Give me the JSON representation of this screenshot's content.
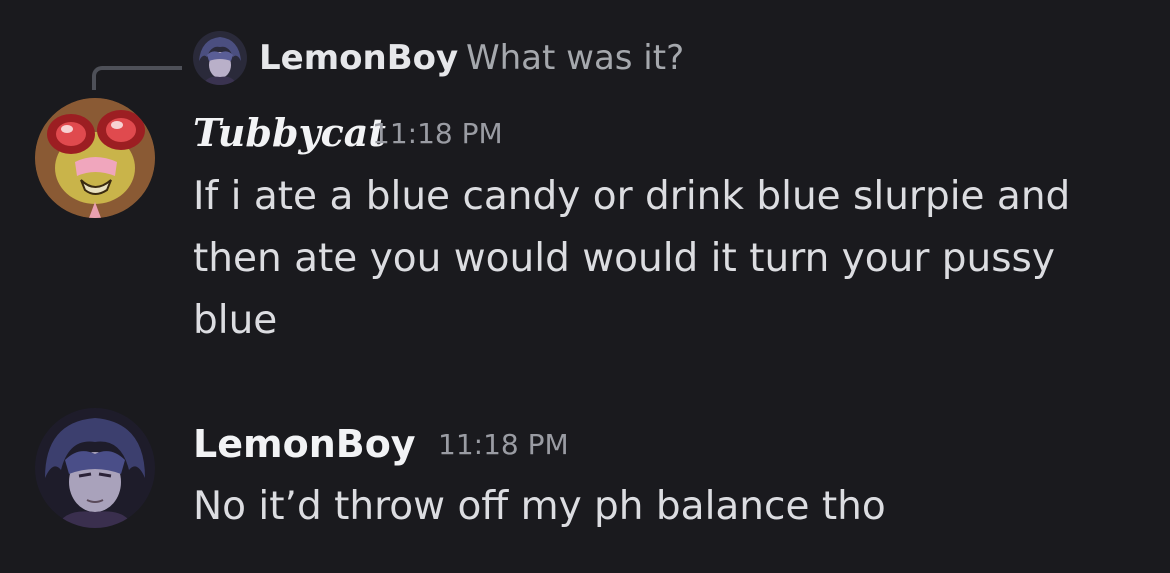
{
  "reply": {
    "author": "LemonBoy",
    "text": "What was it?"
  },
  "messages": [
    {
      "author": "Tubbycat",
      "timestamp": "11:18 PM",
      "text": "If i ate a blue candy or drink blue slurpie and then ate you would would it turn your pussy blue"
    },
    {
      "author": "LemonBoy",
      "timestamp": "11:18 PM",
      "text": "No it’d throw off my ph balance tho"
    }
  ],
  "colors": {
    "background": "#1a1a1e",
    "username": "#f2f3f5",
    "message_text": "#dcdde1",
    "timestamp": "#9a9ca3",
    "reply_line": "#4e5058"
  }
}
